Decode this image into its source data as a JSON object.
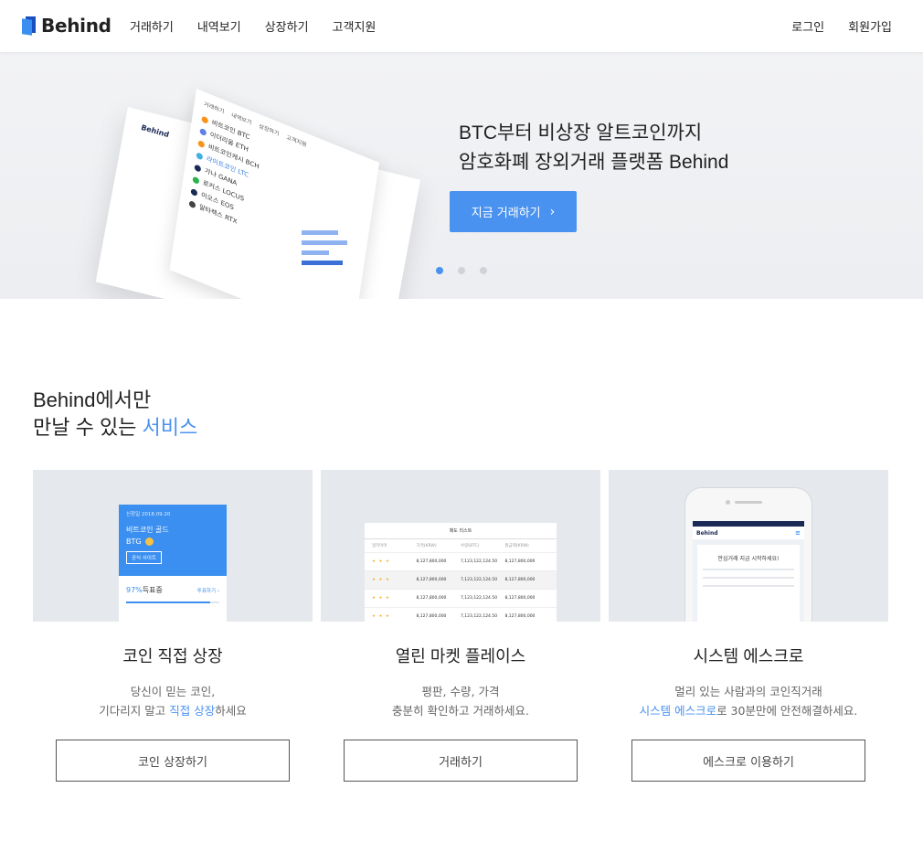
{
  "header": {
    "logo": "Behind",
    "nav": [
      "거래하기",
      "내역보기",
      "상장하기",
      "고객지원"
    ],
    "auth": [
      "로그인",
      "회원가입"
    ]
  },
  "hero": {
    "title_line1": "BTC부터 비상장 알트코인까지",
    "title_line2": "암호화폐 장외거래 플랫폼 Behind",
    "cta": "지금 거래하기",
    "slides": 3,
    "active_slide": 1,
    "mock": {
      "brand": "Behind",
      "menu": [
        "거래하기",
        "내역보기",
        "상장하기",
        "고객지원"
      ],
      "coins": [
        {
          "label": "비트코인 BTC",
          "color": "#f7931a"
        },
        {
          "label": "이더리움 ETH",
          "color": "#627eea"
        },
        {
          "label": "비트코인캐시 BCH",
          "color": "#f7931a"
        },
        {
          "label": "라이트코인 LTC",
          "color": "#40b0e0",
          "active": true
        },
        {
          "label": "가나 GANA",
          "color": "#1a2a55"
        },
        {
          "label": "로커스 LOCUS",
          "color": "#2bb34a"
        },
        {
          "label": "이오스 EOS",
          "color": "#1a2a55"
        },
        {
          "label": "알타렉스 RTX",
          "color": "#444"
        }
      ]
    }
  },
  "services": {
    "title_line1": "Behind에서만",
    "title_line2_prefix": "만날 수 있는 ",
    "title_line2_highlight": "서비스",
    "cards": [
      {
        "title": "코인 직접 상장",
        "desc1": "당신이 믿는 코인,",
        "desc2_prefix": "기다리지 말고 ",
        "desc2_highlight": "직접 상장",
        "desc2_suffix": "하세요",
        "button": "코인 상장하기",
        "mock": {
          "date": "신청일 2018.09.20",
          "name": "비트코인 골드",
          "symbol": "BTG",
          "tag": "공식 사이트",
          "pct": "97%",
          "pct_label": "득표중",
          "link": "투표하기",
          "progress": 0.9
        }
      },
      {
        "title": "열린 마켓 플레이스",
        "desc1": "평판, 수량, 가격",
        "desc2_prefix": "충분히 확인하고 거래하세요.",
        "desc2_highlight": "",
        "desc2_suffix": "",
        "button": "거래하기",
        "mock": {
          "head": "매도 리스트",
          "cols": [
            "일러이어",
            "가격(KRW)",
            "수량(BTC)",
            "총금액(KRW)"
          ],
          "rows": [
            [
              "★ ★ ★",
              "8,127,800,000",
              "7,123,122,124.50",
              "8,127,800,000"
            ],
            [
              "★ ★ ★",
              "8,127,800,000",
              "7,123,122,124.50",
              "8,127,800,000"
            ],
            [
              "★ ★ ★",
              "8,127,800,000",
              "7,123,122,124.50",
              "8,127,800,000"
            ],
            [
              "★ ★ ★",
              "8,127,800,000",
              "7,123,122,124.50",
              "8,127,800,000"
            ]
          ]
        }
      },
      {
        "title": "시스템 에스크로",
        "desc1": "멀리 있는 사람과의 코인직거래",
        "desc2_prefix": "",
        "desc2_highlight": "시스템 에스크로",
        "desc2_suffix": "로 30분만에 안전해결하세요.",
        "button": "에스크로 이용하기",
        "mock": {
          "brand": "Behind",
          "card_title": "안심거래 지금 시작하세요!"
        }
      }
    ]
  }
}
